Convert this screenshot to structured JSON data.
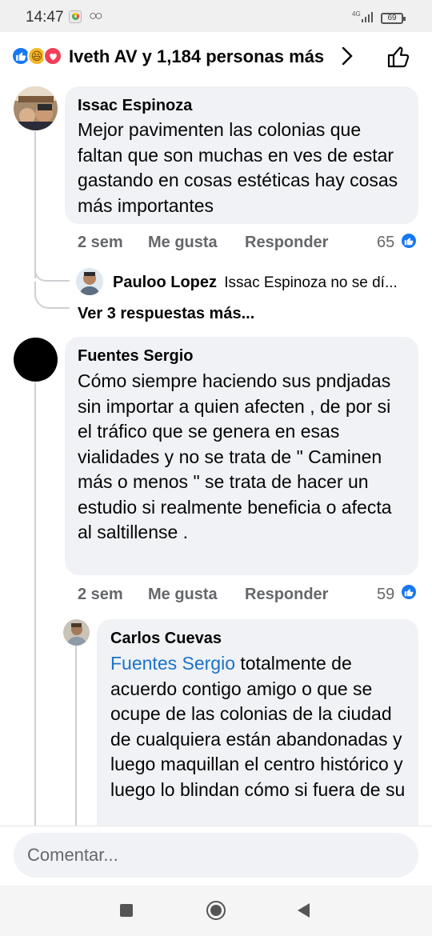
{
  "status_bar": {
    "time": "14:47",
    "network": "4G",
    "battery": "69"
  },
  "reactions_header": {
    "summary": "Iveth AV y 1,184 personas más",
    "reactions": [
      "like-icon",
      "haha-icon",
      "love-icon"
    ]
  },
  "comments": [
    {
      "author": "Issac Espinoza",
      "text": "Mejor pavimenten las colonias que faltan que son muchas en ves de estar gastando en cosas estéticas hay cosas más importantes",
      "time": "2 sem",
      "like_label": "Me gusta",
      "reply_label": "Responder",
      "reaction_count": "65",
      "reply_preview": {
        "author": "Pauloo Lopez",
        "text": "Issac Espinoza no se dí..."
      },
      "more_replies": "Ver 3 respuestas más..."
    },
    {
      "author": "Fuentes Sergio",
      "text": "Cómo siempre haciendo sus pndjadas sin importar a quien afecten , de por si el tráfico que se genera en esas vialidades y no se trata de \" Caminen más o menos \" se trata de hacer un estudio si realmente beneficia o afecta al saltillense .",
      "time": "2 sem",
      "like_label": "Me gusta",
      "reply_label": "Responder",
      "reaction_count": "59",
      "reply": {
        "author": "Carlos Cuevas",
        "mention": "Fuentes Sergio",
        "text": " totalmente de acuerdo contigo amigo o que se ocupe de las colonias de la ciudad de cualquiera están abandonadas y luego maquillan el centro histórico y luego lo blindan cómo si fuera de su"
      }
    }
  ],
  "composer": {
    "placeholder": "Comentar..."
  },
  "nav": {
    "icons": [
      "recent-apps-icon",
      "home-icon",
      "back-icon"
    ]
  },
  "colors": {
    "facebook_blue": "#1877f2",
    "bubble_bg": "#f0f2f5",
    "secondary_text": "#65676b",
    "mention": "#1a73cb"
  }
}
